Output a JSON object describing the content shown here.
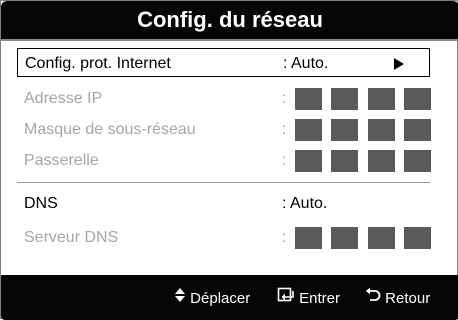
{
  "dialog": {
    "title": "Config. du réseau"
  },
  "rows": [
    {
      "label": "Config. prot. Internet",
      "value": ": Auto.",
      "state": "selected"
    },
    {
      "label": "Adresse IP",
      "value": ":",
      "state": "disabled"
    },
    {
      "label": "Masque de sous-réseau",
      "value": ":",
      "state": "disabled"
    },
    {
      "label": "Passerelle",
      "value": ":",
      "state": "disabled"
    },
    {
      "label": "DNS",
      "value": ": Auto.",
      "state": "enabled"
    },
    {
      "label": "Serveur DNS",
      "value": ":",
      "state": "disabled"
    }
  ],
  "footer": {
    "move_label": "Déplacer",
    "enter_label": "Entrer",
    "return_label": "Retour"
  },
  "icons": {
    "selected_row_arrow": "triangle-right-icon",
    "move": "up-down-arrows-icon",
    "enter": "enter-icon",
    "return": "return-icon"
  },
  "colors": {
    "bar_background": "#050505",
    "disabled_text": "#a6a6a6",
    "ip_box_fill": "#5a5a5a"
  }
}
